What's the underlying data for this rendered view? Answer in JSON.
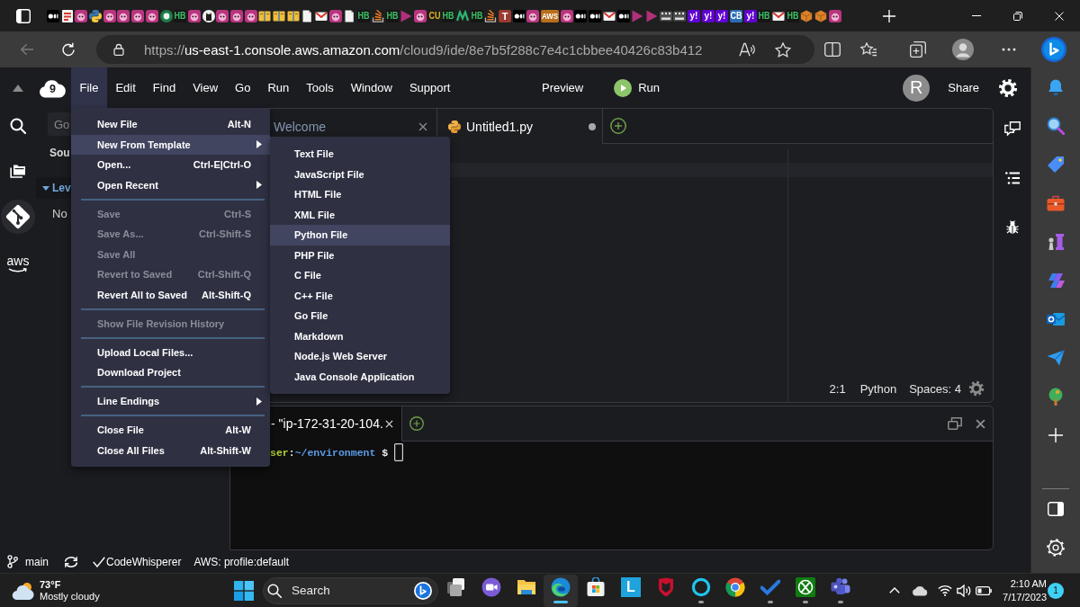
{
  "browser": {
    "tabs": [
      {
        "kind": "dots"
      },
      {
        "kind": "page-red"
      },
      {
        "kind": "face"
      },
      {
        "kind": "python"
      },
      {
        "kind": "face"
      },
      {
        "kind": "face"
      },
      {
        "kind": "face"
      },
      {
        "kind": "face"
      },
      {
        "kind": "circle"
      },
      {
        "kind": "hb",
        "text": "HB"
      },
      {
        "kind": "face"
      },
      {
        "kind": "cat"
      },
      {
        "kind": "face"
      },
      {
        "kind": "face"
      },
      {
        "kind": "face"
      },
      {
        "kind": "book"
      },
      {
        "kind": "book"
      },
      {
        "kind": "book"
      },
      {
        "kind": "page"
      },
      {
        "kind": "envelope"
      },
      {
        "kind": "face"
      },
      {
        "kind": "page"
      },
      {
        "kind": "hb",
        "text": "HB"
      },
      {
        "kind": "stack"
      },
      {
        "kind": "hb",
        "text": "HB"
      },
      {
        "kind": "triangle"
      },
      {
        "kind": "face"
      },
      {
        "kind": "cu",
        "text": "CU"
      },
      {
        "kind": "hb",
        "text": "HB"
      },
      {
        "kind": "zigzag"
      },
      {
        "kind": "hb",
        "text": "HB"
      },
      {
        "kind": "stack"
      },
      {
        "kind": "t",
        "text": "T"
      },
      {
        "kind": "dots"
      },
      {
        "kind": "face"
      },
      {
        "kind": "aws",
        "text": "AWS"
      },
      {
        "kind": "face"
      },
      {
        "kind": "dots"
      },
      {
        "kind": "dots"
      },
      {
        "kind": "envelope"
      },
      {
        "kind": "dots"
      },
      {
        "kind": "triangle"
      },
      {
        "kind": "triangle"
      },
      {
        "kind": "film"
      },
      {
        "kind": "film"
      },
      {
        "kind": "yahoo",
        "text": "y!"
      },
      {
        "kind": "yahoo",
        "text": "y!"
      },
      {
        "kind": "yahoo",
        "text": "y!"
      },
      {
        "kind": "cb",
        "text": "CB"
      },
      {
        "kind": "yahoo",
        "text": "y!"
      },
      {
        "kind": "hb",
        "text": "HB"
      },
      {
        "kind": "envelope"
      },
      {
        "kind": "hb",
        "text": "HB"
      },
      {
        "kind": "cube"
      },
      {
        "kind": "cube"
      },
      {
        "kind": "face"
      }
    ],
    "back_disabled": true,
    "address": {
      "scheme": "https://",
      "host": "us-east-1.console.aws.amazon.com",
      "path": "/cloud9/ide/8e7b5f288c7e4c1cbbee40426c83b412"
    }
  },
  "ide": {
    "logo_text": "9",
    "menu_bar": [
      {
        "label": "File",
        "selected": true
      },
      {
        "label": "Edit",
        "selected": false
      },
      {
        "label": "Find",
        "selected": false
      },
      {
        "label": "View",
        "selected": false
      },
      {
        "label": "Go",
        "selected": false
      },
      {
        "label": "Run",
        "selected": false
      },
      {
        "label": "Tools",
        "selected": false
      },
      {
        "label": "Window",
        "selected": false
      },
      {
        "label": "Support",
        "selected": false
      }
    ],
    "preview": "Preview",
    "run": "Run",
    "avatar": "R",
    "share": "Share",
    "aws_logo": "aws",
    "side_panel": {
      "search_placeholder": "Go",
      "heading": "Sou",
      "section": {
        "label": "Lev",
        "expanded": true
      },
      "message": "No"
    },
    "editor": {
      "tabs": [
        {
          "kind": "welcome",
          "label": "Welcome",
          "selected": false,
          "modified": false
        },
        {
          "kind": "python",
          "label": "Untitled1.py",
          "selected": true,
          "modified": true
        }
      ],
      "cursor": "2:1",
      "language": "Python",
      "indent": "Spaces: 4"
    },
    "terminal": {
      "tabs": [
        {
          "label": "- \"ip-172-31-20-104.",
          "selected": true
        }
      ],
      "prompt": {
        "user": "ser",
        "separator": ":",
        "path": "~/environment",
        "symbol": "$"
      }
    },
    "status_bar": {
      "branch": "main",
      "codewhisperer": "CodeWhisperer",
      "profile": "AWS: profile:default"
    },
    "file_menu": {
      "groups": [
        {
          "items": [
            {
              "label": "New File",
              "shortcut": "Alt-N",
              "disabled": false,
              "selected": false,
              "submenu": false
            },
            {
              "label": "New From Template",
              "disabled": false,
              "selected": true,
              "submenu": true
            },
            {
              "label": "Open...",
              "shortcut": "Ctrl-E|Ctrl-O",
              "disabled": false,
              "selected": false,
              "submenu": false
            },
            {
              "label": "Open Recent",
              "disabled": false,
              "selected": false,
              "submenu": true
            }
          ]
        },
        {
          "items": [
            {
              "label": "Save",
              "shortcut": "Ctrl-S",
              "disabled": true,
              "selected": false,
              "submenu": false
            },
            {
              "label": "Save As...",
              "shortcut": "Ctrl-Shift-S",
              "disabled": true,
              "selected": false,
              "submenu": false
            },
            {
              "label": "Save All",
              "disabled": true,
              "selected": false,
              "submenu": false
            },
            {
              "label": "Revert to Saved",
              "shortcut": "Ctrl-Shift-Q",
              "disabled": true,
              "selected": false,
              "submenu": false
            },
            {
              "label": "Revert All to Saved",
              "shortcut": "Alt-Shift-Q",
              "disabled": false,
              "selected": false,
              "submenu": false
            }
          ]
        },
        {
          "items": [
            {
              "label": "Show File Revision History",
              "disabled": true,
              "selected": false,
              "submenu": false
            }
          ]
        },
        {
          "items": [
            {
              "label": "Upload Local Files...",
              "disabled": false,
              "selected": false,
              "submenu": false
            },
            {
              "label": "Download Project",
              "disabled": false,
              "selected": false,
              "submenu": false
            }
          ]
        },
        {
          "items": [
            {
              "label": "Line Endings",
              "disabled": false,
              "selected": false,
              "submenu": true
            }
          ]
        },
        {
          "items": [
            {
              "label": "Close File",
              "shortcut": "Alt-W",
              "disabled": false,
              "selected": false,
              "submenu": false
            },
            {
              "label": "Close All Files",
              "shortcut": "Alt-Shift-W",
              "disabled": false,
              "selected": false,
              "submenu": false
            }
          ]
        }
      ]
    },
    "template_menu": {
      "items": [
        {
          "label": "Text File",
          "selected": false
        },
        {
          "label": "JavaScript File",
          "selected": false
        },
        {
          "label": "HTML File",
          "selected": false
        },
        {
          "label": "XML File",
          "selected": false
        },
        {
          "label": "Python File",
          "selected": true
        },
        {
          "label": "PHP File",
          "selected": false
        },
        {
          "label": "C File",
          "selected": false
        },
        {
          "label": "C++ File",
          "selected": false
        },
        {
          "label": "Go File",
          "selected": false
        },
        {
          "label": "Markdown",
          "selected": false
        },
        {
          "label": "Node.js Web Server",
          "selected": false
        },
        {
          "label": "Java Console Application",
          "selected": false
        }
      ]
    }
  },
  "taskbar": {
    "weather": {
      "temperature": "73°F",
      "condition": "Mostly cloudy"
    },
    "search_placeholder": "Search",
    "apps": [
      {
        "kind": "task-view",
        "selected": false,
        "running": false
      },
      {
        "kind": "chat",
        "selected": false,
        "running": false
      },
      {
        "kind": "explorer",
        "selected": false,
        "running": false
      },
      {
        "kind": "edge",
        "selected": true,
        "running": true
      },
      {
        "kind": "store",
        "selected": false,
        "running": false
      },
      {
        "kind": "tile",
        "label": "L",
        "selected": false,
        "running": false
      },
      {
        "kind": "shield",
        "selected": false,
        "running": false
      },
      {
        "kind": "ring",
        "selected": false,
        "running": true
      },
      {
        "kind": "chrome",
        "selected": false,
        "running": false
      },
      {
        "kind": "tick",
        "selected": false,
        "running": true
      },
      {
        "kind": "xbox",
        "selected": false,
        "running": true
      },
      {
        "kind": "teams",
        "selected": false,
        "running": true
      }
    ],
    "clock": {
      "time": "2:10 AM",
      "date": "7/17/2023"
    },
    "notifications": "1"
  }
}
